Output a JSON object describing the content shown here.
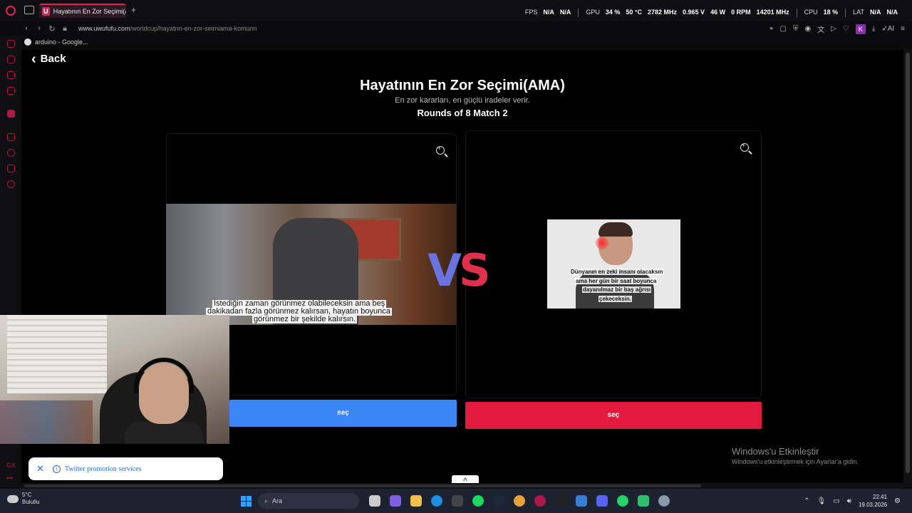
{
  "browser": {
    "tab_title": "Hayatının En Zor Seçimi(AM",
    "tab_favicon": "U",
    "new_tab": "+",
    "url_host": "www.uwufufu.com",
    "url_path": "/worldcup/hayatnn-en-zor-seimiama-komunn",
    "bookmark": "arduino - Google...",
    "profile_letter": "K",
    "ai_label": "AI"
  },
  "stats": {
    "fps_label": "FPS",
    "fps_v1": "N/A",
    "fps_v2": "N/A",
    "gpu_label": "GPU",
    "gpu_usage": "34 %",
    "gpu_temp": "50 °C",
    "gpu_clock": "2782 MHz",
    "gpu_volt": "0.965 V",
    "gpu_power": "46 W",
    "gpu_fan": "0 RPM",
    "gpu_mem": "14201 MHz",
    "cpu_label": "CPU",
    "cpu_usage": "18 %",
    "lat_label": "LAT",
    "lat_v1": "N/A",
    "lat_v2": "N/A"
  },
  "page": {
    "back_label": "Back",
    "title": "Hayatının En Zor Seçimi(AMA)",
    "subtitle": "En zor kararları, en güçlü iradeler verir.",
    "rounds": "Rounds of 8 Match 2",
    "vs_v": "V",
    "vs_s": "S",
    "left_caption": [
      "İstediğin zaman görünmez olabileceksin ama beş",
      "dakikadan fazla görünmez kalırsan, hayatın boyunca",
      "görünmez bir şekilde kalırsın."
    ],
    "right_caption": [
      "Dünyanın en zeki insanı olacaksın",
      "ama her gün bir saat boyunca",
      "dayanılmaz bir baş ağrısı",
      "çekeceksin."
    ],
    "select_left": "seç",
    "select_right": "seç",
    "scroll_up": "^"
  },
  "toast": {
    "text": "Twitter promotion services"
  },
  "windows_activation": {
    "title": "Windows'u Etkinleştir",
    "message": "Windows'u etkinleştirmek için Ayarlar'a gidin."
  },
  "taskbar": {
    "temp": "5°C",
    "weather": "Bulutlu",
    "search_placeholder": "Ara",
    "time": "22:41",
    "date": "19.03.2026"
  },
  "colors": {
    "accent": "#e0245e",
    "select_left": "#3a86f5",
    "select_right": "#e4193f",
    "vs_v": "#6a74e0",
    "vs_s": "#e0304e"
  }
}
